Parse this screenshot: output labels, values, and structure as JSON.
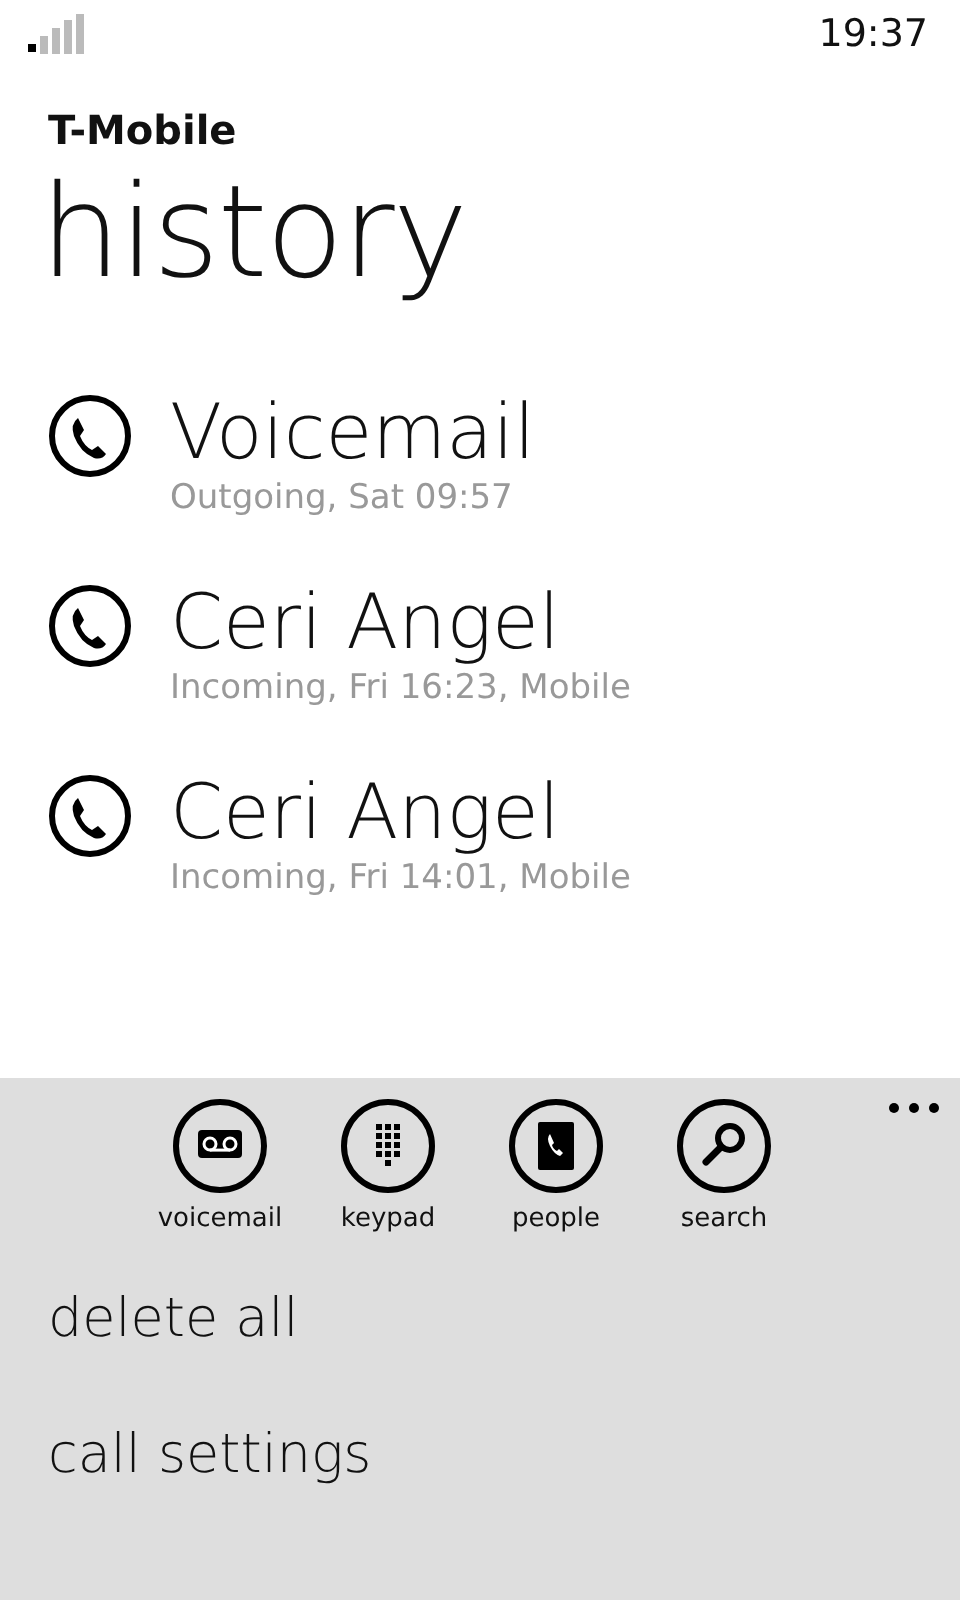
{
  "status_bar": {
    "time": "19:37"
  },
  "header": {
    "carrier": "T-Mobile",
    "title": "history"
  },
  "calls": [
    {
      "name": "Voicemail",
      "detail": "Outgoing, Sat 09:57"
    },
    {
      "name": "Ceri Angel",
      "detail": "Incoming, Fri 16:23, Mobile"
    },
    {
      "name": "Ceri Angel",
      "detail": "Incoming, Fri 14:01, Mobile"
    }
  ],
  "app_bar": {
    "buttons": [
      {
        "kind": "voicemail",
        "label": "voicemail"
      },
      {
        "kind": "keypad",
        "label": "keypad"
      },
      {
        "kind": "people",
        "label": "people"
      },
      {
        "kind": "search",
        "label": "search"
      }
    ],
    "menu_items": [
      "delete all",
      "call settings"
    ]
  }
}
